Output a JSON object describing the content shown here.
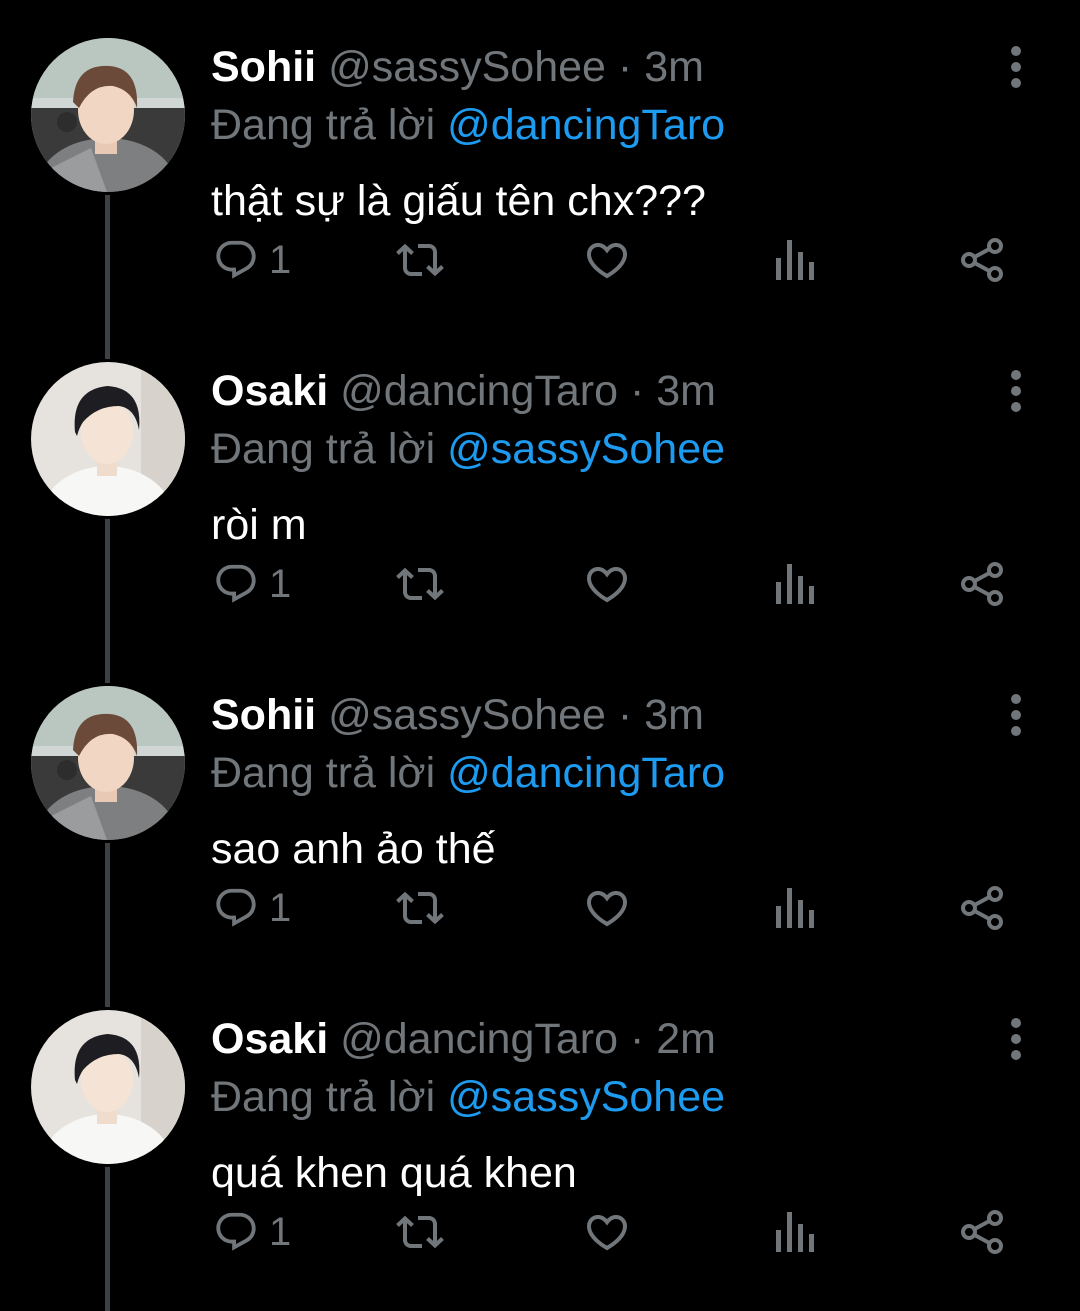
{
  "colors": {
    "background": "#000000",
    "primary_text": "#ffffff",
    "secondary_text": "#71767b",
    "mention": "#1d9bf0",
    "thread_line": "#3d4144"
  },
  "tweets": [
    {
      "display_name": "Sohii",
      "handle": "@sassySohee",
      "separator": "·",
      "time": "3m",
      "reply_prefix": "Đang trả lời",
      "reply_to": "@dancingTaro",
      "text": "thật sự là giấu tên chx???",
      "reply_count": "1",
      "avatar_icon": "avatar-sohii-photo"
    },
    {
      "display_name": "Osaki",
      "handle": "@dancingTaro",
      "separator": "·",
      "time": "3m",
      "reply_prefix": "Đang trả lời",
      "reply_to": "@sassySohee",
      "text": "ròi m",
      "reply_count": "1",
      "avatar_icon": "avatar-osaki-photo"
    },
    {
      "display_name": "Sohii",
      "handle": "@sassySohee",
      "separator": "·",
      "time": "3m",
      "reply_prefix": "Đang trả lời",
      "reply_to": "@dancingTaro",
      "text": "sao anh ảo thế",
      "reply_count": "1",
      "avatar_icon": "avatar-sohii-photo"
    },
    {
      "display_name": "Osaki",
      "handle": "@dancingTaro",
      "separator": "·",
      "time": "2m",
      "reply_prefix": "Đang trả lời",
      "reply_to": "@sassySohee",
      "text": "quá khen quá khen",
      "reply_count": "1",
      "avatar_icon": "avatar-osaki-photo"
    }
  ],
  "action_icons": [
    "reply-icon",
    "retweet-icon",
    "like-icon",
    "analytics-icon",
    "share-icon"
  ]
}
